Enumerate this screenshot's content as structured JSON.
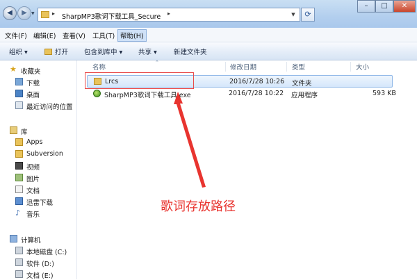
{
  "window": {
    "address_path": "SharpMP3歌词下载工具_Secure",
    "buttons": {
      "minimize": "–",
      "maximize": "□",
      "close": "✕"
    }
  },
  "menubar": [
    {
      "label": "文件(F)"
    },
    {
      "label": "编辑(E)"
    },
    {
      "label": "查看(V)"
    },
    {
      "label": "工具(T)"
    },
    {
      "label": "帮助(H)"
    }
  ],
  "toolbar": {
    "organize": "组织 ▾",
    "open": "打开",
    "include_library": "包含到库中 ▾",
    "share": "共享 ▾",
    "new_folder": "新建文件夹"
  },
  "nav": {
    "favorites": {
      "header": "收藏夹",
      "items": [
        "下载",
        "桌面",
        "最近访问的位置"
      ]
    },
    "libraries": {
      "header": "库",
      "items": [
        "Apps",
        "Subversion",
        "视频",
        "图片",
        "文档",
        "迅雷下载",
        "音乐"
      ]
    },
    "computer": {
      "header": "计算机",
      "items": [
        "本地磁盘 (C:)",
        "软件 (D:)",
        "文档 (E:)"
      ]
    }
  },
  "columns": {
    "name": "名称",
    "modified": "修改日期",
    "type": "类型",
    "size": "大小"
  },
  "files": [
    {
      "name": "Lrcs",
      "modified": "2016/7/28 10:26",
      "type": "文件夹",
      "size": "",
      "selected": true,
      "icon": "folder-icon"
    },
    {
      "name": "SharpMP3歌词下载工具.exe",
      "modified": "2016/7/28 10:22",
      "type": "应用程序",
      "size": "593 KB",
      "selected": false,
      "icon": "app-icon"
    }
  ],
  "annotation": {
    "text": "歌词存放路径",
    "color": "#e8342f"
  },
  "colors": {
    "accent": "#3b6aa8",
    "annotation_red": "#e8342f",
    "folder_yellow": "#e9c35a"
  }
}
